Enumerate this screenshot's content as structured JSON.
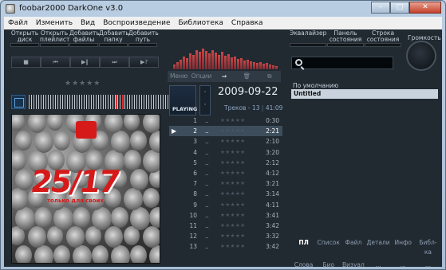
{
  "window": {
    "title": "foobar2000 DarkOne v3.0"
  },
  "menu": [
    "Файл",
    "Изменить",
    "Вид",
    "Воспроизведение",
    "Библиотека",
    "Справка"
  ],
  "top_buttons": [
    "Открыть\nдиск",
    "Открыть\nплейлист",
    "Добавить\nфайлы",
    "Добавить\nпапку",
    "Добавить\nпуть"
  ],
  "transport": {
    "stop": "■",
    "prev": "⏮",
    "playpause": "▶‖",
    "next": "⏭",
    "random": "▶?"
  },
  "right_top_buttons": [
    "Эквалайзер",
    "Панель\nсостояния",
    "Строка\nсостояния"
  ],
  "volume_label": "Громкость",
  "rating_stars": "★★★★★",
  "middle_tabs": [
    "Меню",
    "Опции",
    "⇒",
    "🗑",
    "⧉"
  ],
  "now_playing": {
    "playing_label": "PLAYING",
    "date": "2009-09-22",
    "tracks_label": "Треков - 13",
    "total_time": "41:09"
  },
  "tracks": [
    {
      "num": "1",
      "dots": "..",
      "stars": "★★★★★",
      "time": "0:30",
      "active": false
    },
    {
      "num": "2",
      "dots": "..",
      "stars": "★★★★★",
      "time": "2:21",
      "active": true
    },
    {
      "num": "3",
      "dots": "..",
      "stars": "★★★★★",
      "time": "2:10",
      "active": false
    },
    {
      "num": "4",
      "dots": "..",
      "stars": "★★★★★",
      "time": "3:20",
      "active": false
    },
    {
      "num": "5",
      "dots": "..",
      "stars": "★★★★★",
      "time": "2:12",
      "active": false
    },
    {
      "num": "6",
      "dots": "..",
      "stars": "★★★★★",
      "time": "4:12",
      "active": false
    },
    {
      "num": "7",
      "dots": "..",
      "stars": "★★★★★",
      "time": "3:21",
      "active": false
    },
    {
      "num": "8",
      "dots": "..",
      "stars": "★★★★★",
      "time": "3:14",
      "active": false
    },
    {
      "num": "9",
      "dots": "..",
      "stars": "★★★★★",
      "time": "4:11",
      "active": false
    },
    {
      "num": "10",
      "dots": "..",
      "stars": "★★★★★",
      "time": "3:41",
      "active": false
    },
    {
      "num": "11",
      "dots": "..",
      "stars": "★★★★★",
      "time": "3:42",
      "active": false
    },
    {
      "num": "12",
      "dots": "..",
      "stars": "★★★★★",
      "time": "3:32",
      "active": false
    },
    {
      "num": "13",
      "dots": "..",
      "stars": "★★★★★",
      "time": "3:42",
      "active": false
    }
  ],
  "playlist_manager": {
    "header": "По умолчанию",
    "selected": "Untitled"
  },
  "bottom_tabs": [
    {
      "label": "ПЛ",
      "active": true
    },
    {
      "label": "Список",
      "active": false
    },
    {
      "label": "Файл",
      "active": false
    },
    {
      "label": "Детали",
      "active": false
    },
    {
      "label": "Инфо",
      "active": false
    },
    {
      "label": "Библ-ка",
      "active": false
    },
    {
      "label": "Слова",
      "active": false
    },
    {
      "label": "Био",
      "active": false
    },
    {
      "label": "Визуал",
      "active": false
    },
    {
      "label": "...",
      "active": false
    },
    {
      "label": "...",
      "active": false
    },
    {
      "label": "...",
      "active": false
    }
  ],
  "album_art": {
    "logo_text": "25/17",
    "subtitle": "только для своих"
  },
  "colors": {
    "background": "#212931",
    "accent_red": "#d61a1a",
    "selection": "#3d4d5c"
  }
}
